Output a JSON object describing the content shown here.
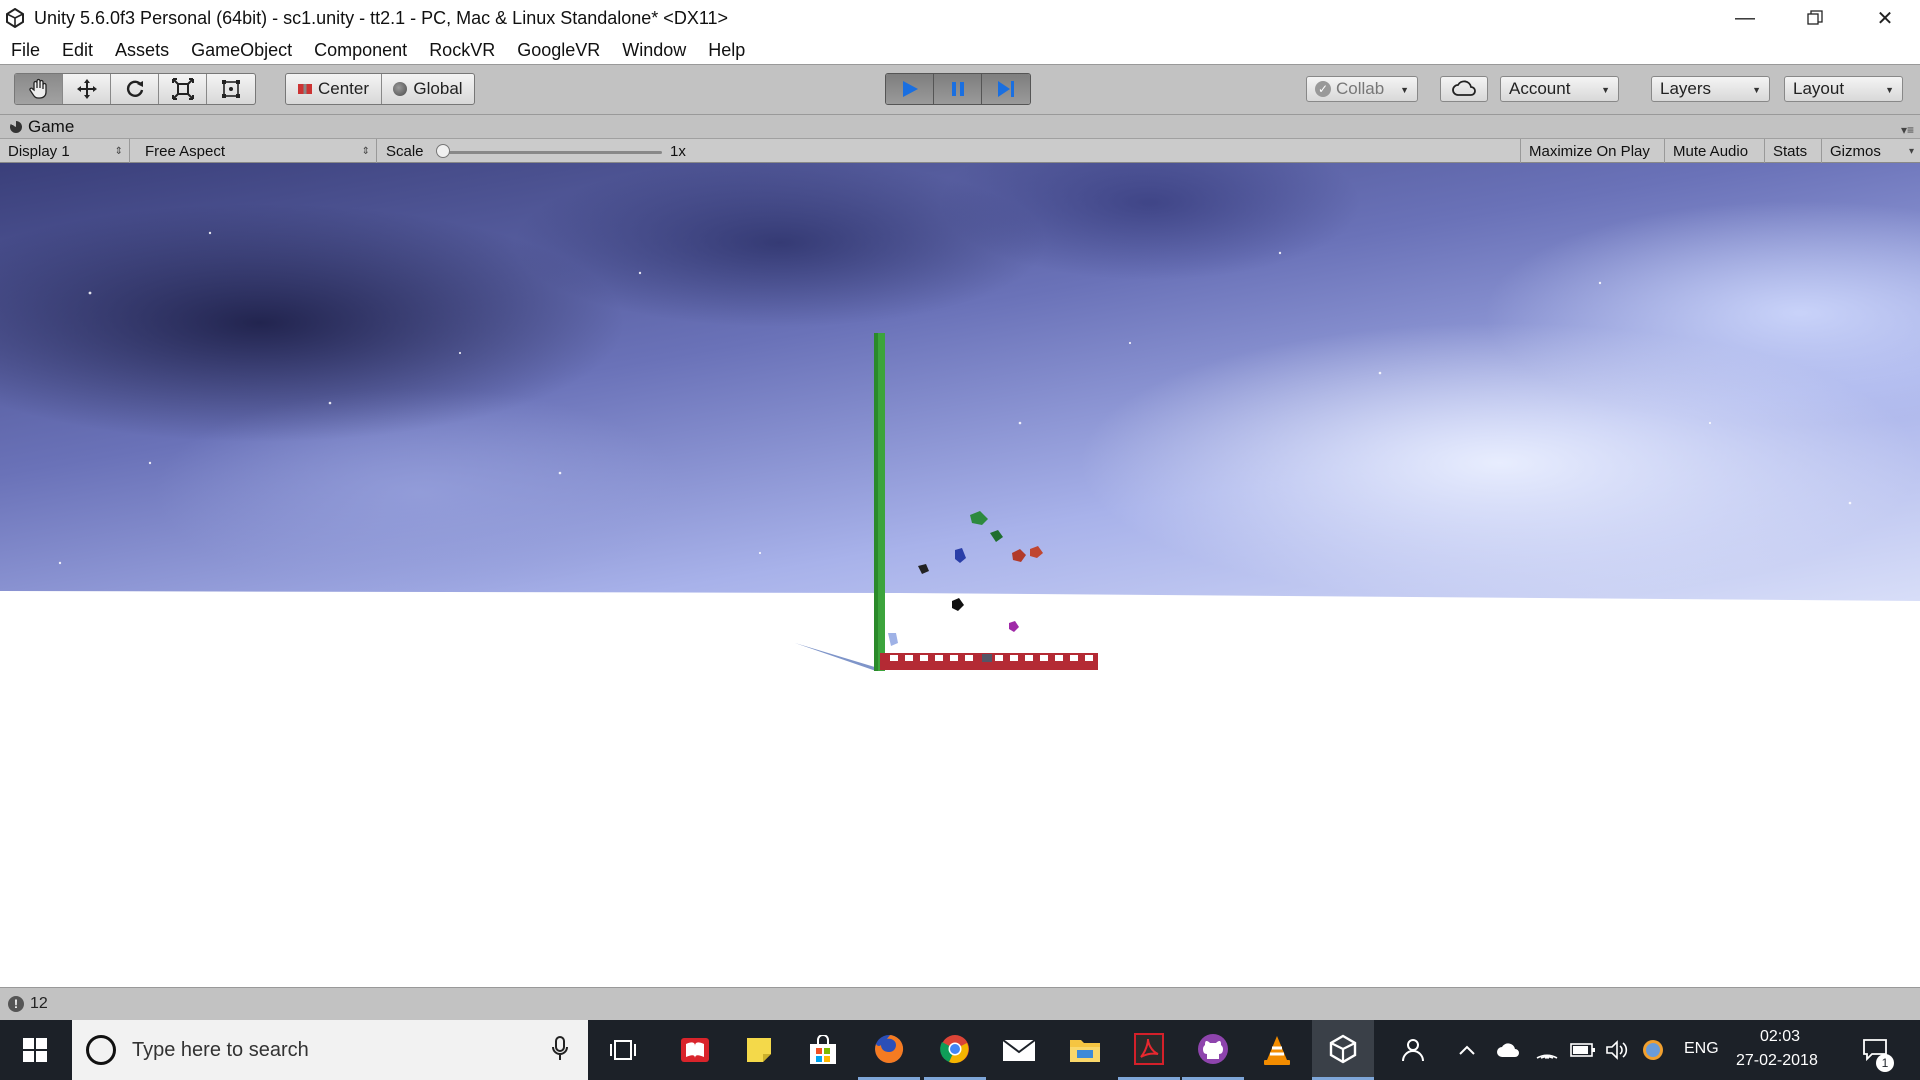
{
  "window": {
    "title": "Unity 5.6.0f3 Personal (64bit) - sc1.unity - tt2.1 - PC, Mac & Linux Standalone* <DX11>",
    "icon": "unity-logo-icon",
    "controls": [
      "minimize-icon",
      "restore-icon",
      "close-icon"
    ]
  },
  "menu": [
    "File",
    "Edit",
    "Assets",
    "GameObject",
    "Component",
    "RockVR",
    "GoogleVR",
    "Window",
    "Help"
  ],
  "toolbar": {
    "transform_tools": [
      "hand-tool-icon",
      "move-tool-icon",
      "rotate-tool-icon",
      "scale-tool-icon",
      "rect-tool-icon"
    ],
    "pivot_mode": "Center",
    "pivot_rotation": "Global",
    "play_buttons": [
      "play-icon",
      "pause-icon",
      "step-icon"
    ],
    "collab": "Collab",
    "account": "Account",
    "layers": "Layers",
    "layout": "Layout",
    "play_accent": "#1a6fe0"
  },
  "game_view": {
    "tab": "Game",
    "display": "Display 1",
    "aspect": "Free Aspect",
    "scale_label": "Scale",
    "scale_value": "1x",
    "maximize_on_play": "Maximize On Play",
    "mute_audio": "Mute Audio",
    "stats": "Stats",
    "gizmos": "Gizmos"
  },
  "status": {
    "count": "12"
  },
  "taskbar": {
    "search_placeholder": "Type here to search",
    "apps": [
      "task-view-icon",
      "reader-icon",
      "sticky-notes-icon",
      "store-icon",
      "firefox-icon",
      "chrome-icon",
      "mail-icon",
      "file-explorer-icon",
      "acrobat-icon",
      "github-icon",
      "vlc-icon",
      "unity-icon"
    ],
    "language": "ENG",
    "time": "02:03",
    "date": "27-02-2018",
    "notifications": "1"
  }
}
